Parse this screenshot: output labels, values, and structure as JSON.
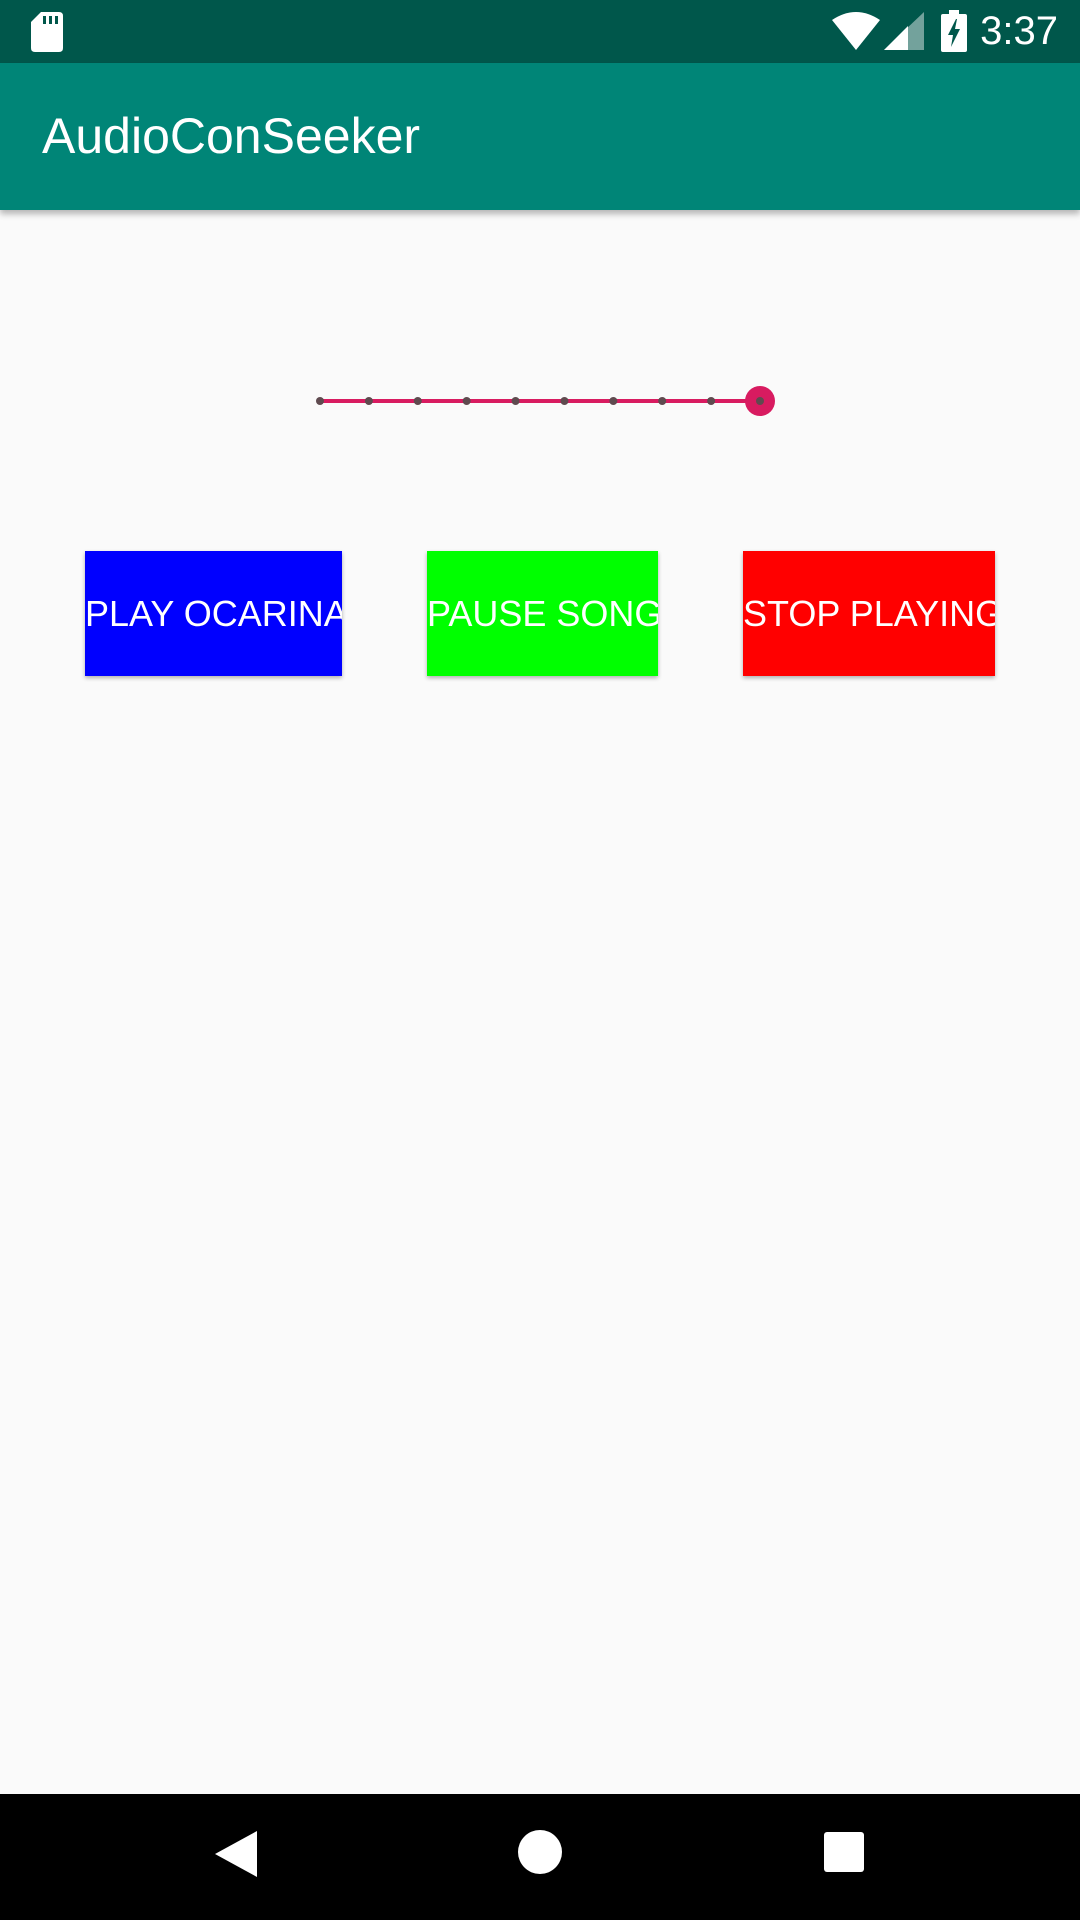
{
  "status_bar": {
    "time": "3:37",
    "icons": [
      "sd-card-icon",
      "wifi-icon",
      "cell-signal-icon",
      "battery-charging-icon"
    ]
  },
  "app_bar": {
    "title": "AudioConSeeker"
  },
  "seekbar": {
    "tick_count": 10,
    "value": 9,
    "max": 9,
    "accent_color": "#d81b60",
    "tick_color": "#5f4a4f"
  },
  "buttons": {
    "play": {
      "label": "PLAY OCARINA",
      "color": "#0000ff"
    },
    "pause": {
      "label": "PAUSE SONG",
      "color": "#00ff00"
    },
    "stop": {
      "label": "STOP PLAYING",
      "color": "#ff0000"
    }
  },
  "nav_bar": {
    "icons": [
      "back-icon",
      "home-icon",
      "recents-icon"
    ]
  },
  "colors": {
    "status_bar": "#00574b",
    "app_bar": "#008577",
    "background": "#fafafa",
    "nav_bar": "#000000"
  }
}
